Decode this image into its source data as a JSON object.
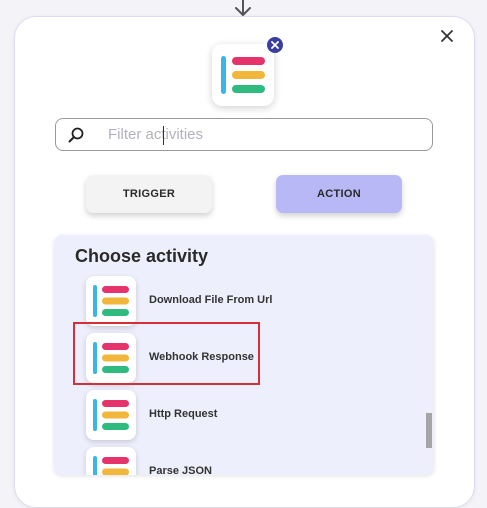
{
  "search": {
    "placeholder": "Filter activities",
    "value": ""
  },
  "buttons": {
    "trigger": "TRIGGER",
    "action": "ACTION"
  },
  "activities": {
    "title": "Choose activity",
    "items": [
      {
        "label": "Download File From Url"
      },
      {
        "label": "Webhook Response"
      },
      {
        "label": "Http Request"
      },
      {
        "label": "Parse JSON"
      }
    ]
  },
  "colors": {
    "action_button": "#b8b8f6",
    "highlight": "#d42f3a",
    "logo_blue": "#38b7e6",
    "logo_pink": "#e6336b",
    "logo_yellow": "#f2b63a",
    "logo_green": "#2fba7f"
  },
  "icons": {
    "top_arrow": "arrow-down-icon",
    "close": "close-icon",
    "remove": "remove-badge-icon",
    "search": "search-icon",
    "activity": "activity-logo-icon"
  }
}
